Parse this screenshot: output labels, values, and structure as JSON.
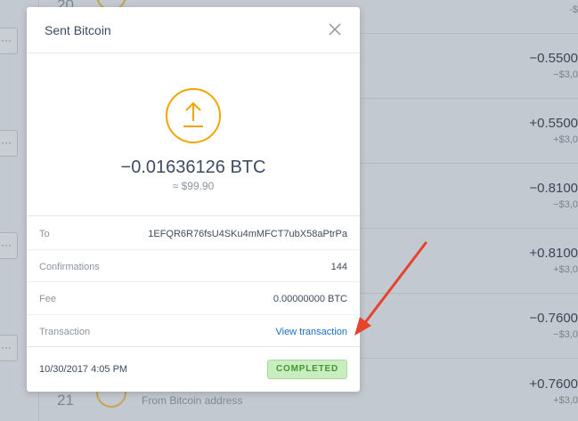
{
  "background": {
    "top_day": "20",
    "bottom_day": "21",
    "bottom_description": "From Bitcoin address",
    "more_label": "···",
    "amounts": [
      {
        "btc": "",
        "usd": "-$"
      },
      {
        "btc": "−0.5500",
        "usd": "−$3,0"
      },
      {
        "btc": "+0.5500",
        "usd": "+$3,0"
      },
      {
        "btc": "−0.8100",
        "usd": "−$3,0"
      },
      {
        "btc": "+0.8100",
        "usd": "+$3,0"
      },
      {
        "btc": "−0.7600",
        "usd": "−$3,0"
      },
      {
        "btc": "+0.7600",
        "usd": "+$3,0"
      }
    ]
  },
  "modal": {
    "title": "Sent Bitcoin",
    "close_icon": "close-icon",
    "direction_icon": "upload-arrow-icon",
    "btc_amount": "−0.01636126 BTC",
    "usd_amount": "≈ $99.90",
    "details": [
      {
        "label": "To",
        "value": "1EFQR6R76fsU4SKu4mMFCT7ubX58aPtrPa"
      },
      {
        "label": "Confirmations",
        "value": "144"
      },
      {
        "label": "Fee",
        "value": "0.00000000 BTC"
      },
      {
        "label": "Transaction",
        "value": "View transaction"
      }
    ],
    "date": "10/30/2017 4:05 PM",
    "status": "COMPLETED"
  },
  "colors": {
    "accent_orange": "#f0a500",
    "link_blue": "#1a6fc2",
    "status_green": "#3f9a2e",
    "annotation_red": "#e8412c"
  }
}
